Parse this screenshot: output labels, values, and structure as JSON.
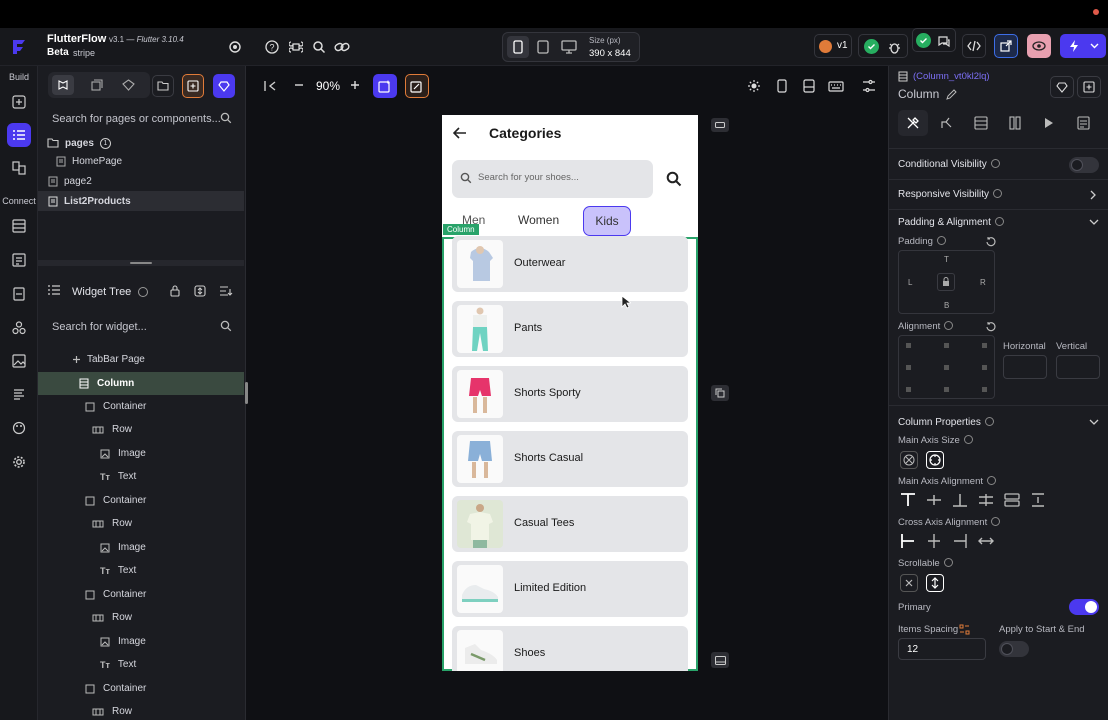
{
  "app": {
    "name": "FlutterFlow",
    "version": "v3.1",
    "flutter": "— Flutter 3.10.4",
    "badge": "Beta",
    "project": "stripe",
    "size_label": "Size (px)",
    "size_value": "390 x 844",
    "version_pill": "v1",
    "zoom": "90%"
  },
  "rail": {
    "build_label": "Build",
    "connect_label": "Connect"
  },
  "pages_panel": {
    "search_placeholder": "Search for pages or components...",
    "folder": "pages",
    "folder_badge": "1",
    "items": [
      "HomePage",
      "page2",
      "List2Products"
    ]
  },
  "widget_tree": {
    "title": "Widget Tree",
    "search_placeholder": "Search for widget...",
    "rows": [
      {
        "label": "TabBar Page"
      },
      {
        "label": "Column"
      },
      {
        "label": "Container"
      },
      {
        "label": "Row"
      },
      {
        "label": "Image"
      },
      {
        "label": "Text"
      },
      {
        "label": "Container"
      },
      {
        "label": "Row"
      },
      {
        "label": "Image"
      },
      {
        "label": "Text"
      },
      {
        "label": "Container"
      },
      {
        "label": "Row"
      },
      {
        "label": "Image"
      },
      {
        "label": "Text"
      },
      {
        "label": "Container"
      },
      {
        "label": "Row"
      }
    ]
  },
  "phone": {
    "title": "Categories",
    "search_placeholder": "Search for your shoes...",
    "tabs": [
      "Men",
      "Women",
      "Kids"
    ],
    "column_tag": "Column",
    "categories": [
      "Outerwear",
      "Pants",
      "Shorts Sporty",
      "Shorts Casual",
      "Casual Tees",
      "Limited Edition",
      "Shoes"
    ]
  },
  "props": {
    "widget_id": "(Column_vt0kl2lq)",
    "widget_type": "Column",
    "conditional_visibility": "Conditional Visibility",
    "responsive_visibility": "Responsive Visibility",
    "padding_alignment": "Padding & Alignment",
    "padding": "Padding",
    "pad_t": "T",
    "pad_l": "L",
    "pad_r": "R",
    "pad_b": "B",
    "alignment": "Alignment",
    "horizontal": "Horizontal",
    "vertical": "Vertical",
    "column_properties": "Column Properties",
    "main_axis_size": "Main Axis Size",
    "main_axis_alignment": "Main Axis Alignment",
    "cross_axis_alignment": "Cross Axis Alignment",
    "scrollable": "Scrollable",
    "primary": "Primary",
    "items_spacing": "Items Spacing",
    "items_spacing_value": "12",
    "apply_start_end": "Apply to Start & End"
  },
  "colors": {
    "accent": "#4b39ef",
    "success": "#27ae60",
    "warning": "#e07b39"
  }
}
